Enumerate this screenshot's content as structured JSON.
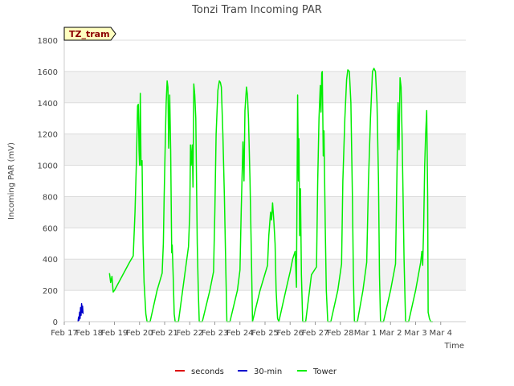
{
  "chart_data": {
    "type": "line",
    "title": "Tonzi Tram Incoming PAR",
    "xlabel": "Time",
    "ylabel": "Incoming PAR (mV)",
    "ylim": [
      0,
      1800
    ],
    "xlim": [
      0,
      16
    ],
    "yticks": [
      0,
      200,
      400,
      600,
      800,
      1000,
      1200,
      1400,
      1600,
      1800
    ],
    "xticks": [
      {
        "x": 0,
        "label": "Feb 17"
      },
      {
        "x": 1,
        "label": "Feb 18"
      },
      {
        "x": 2,
        "label": "Feb 19"
      },
      {
        "x": 3,
        "label": "Feb 20"
      },
      {
        "x": 4,
        "label": "Feb 21"
      },
      {
        "x": 5,
        "label": "Feb 22"
      },
      {
        "x": 6,
        "label": "Feb 23"
      },
      {
        "x": 7,
        "label": "Feb 24"
      },
      {
        "x": 8,
        "label": "Feb 25"
      },
      {
        "x": 9,
        "label": "Feb 26"
      },
      {
        "x": 10,
        "label": "Feb 27"
      },
      {
        "x": 11,
        "label": "Feb 28"
      },
      {
        "x": 12,
        "label": "Mar 1"
      },
      {
        "x": 13,
        "label": "Mar 2"
      },
      {
        "x": 14,
        "label": "Mar 3"
      },
      {
        "x": 15,
        "label": "Mar 4"
      }
    ],
    "grid": "horizontal bands",
    "legend_position": "bottom",
    "annotation": "TZ_tram",
    "series": [
      {
        "name": "seconds",
        "color": "#dd0000",
        "points": []
      },
      {
        "name": "30-min",
        "color": "#0000cc",
        "points": [
          [
            0.55,
            0
          ],
          [
            0.57,
            30
          ],
          [
            0.59,
            10
          ],
          [
            0.61,
            60
          ],
          [
            0.63,
            20
          ],
          [
            0.65,
            90
          ],
          [
            0.67,
            40
          ],
          [
            0.69,
            115
          ],
          [
            0.71,
            60
          ],
          [
            0.73,
            100
          ],
          [
            0.75,
            50
          ]
        ]
      },
      {
        "name": "Tower",
        "color": "#00ee00",
        "points": [
          [
            1.8,
            310
          ],
          [
            1.85,
            250
          ],
          [
            1.9,
            290
          ],
          [
            1.95,
            190
          ],
          [
            2.0,
            200
          ],
          [
            2.6,
            380
          ],
          [
            2.75,
            420
          ],
          [
            2.82,
            700
          ],
          [
            2.88,
            1050
          ],
          [
            2.92,
            1380
          ],
          [
            2.95,
            1390
          ],
          [
            2.98,
            1100
          ],
          [
            3.0,
            1000
          ],
          [
            3.03,
            1460
          ],
          [
            3.06,
            1000
          ],
          [
            3.1,
            1030
          ],
          [
            3.14,
            500
          ],
          [
            3.18,
            250
          ],
          [
            3.25,
            50
          ],
          [
            3.3,
            0
          ],
          [
            3.42,
            0
          ],
          [
            3.7,
            200
          ],
          [
            3.9,
            310
          ],
          [
            3.95,
            500
          ],
          [
            3.98,
            800
          ],
          [
            4.02,
            1100
          ],
          [
            4.06,
            1400
          ],
          [
            4.1,
            1540
          ],
          [
            4.13,
            1500
          ],
          [
            4.16,
            1110
          ],
          [
            4.2,
            1450
          ],
          [
            4.24,
            1100
          ],
          [
            4.28,
            440
          ],
          [
            4.3,
            490
          ],
          [
            4.34,
            300
          ],
          [
            4.38,
            50
          ],
          [
            4.42,
            0
          ],
          [
            4.55,
            0
          ],
          [
            4.8,
            300
          ],
          [
            4.95,
            480
          ],
          [
            5.0,
            700
          ],
          [
            5.03,
            1130
          ],
          [
            5.06,
            1000
          ],
          [
            5.1,
            1130
          ],
          [
            5.13,
            860
          ],
          [
            5.16,
            1520
          ],
          [
            5.2,
            1450
          ],
          [
            5.24,
            1300
          ],
          [
            5.27,
            900
          ],
          [
            5.3,
            500
          ],
          [
            5.34,
            200
          ],
          [
            5.38,
            0
          ],
          [
            5.5,
            0
          ],
          [
            5.8,
            200
          ],
          [
            5.95,
            320
          ],
          [
            6.0,
            700
          ],
          [
            6.05,
            1200
          ],
          [
            6.12,
            1480
          ],
          [
            6.18,
            1540
          ],
          [
            6.22,
            1530
          ],
          [
            6.26,
            1500
          ],
          [
            6.32,
            1200
          ],
          [
            6.38,
            800
          ],
          [
            6.44,
            300
          ],
          [
            6.48,
            0
          ],
          [
            6.6,
            0
          ],
          [
            6.9,
            200
          ],
          [
            7.0,
            330
          ],
          [
            7.05,
            700
          ],
          [
            7.12,
            1150
          ],
          [
            7.16,
            900
          ],
          [
            7.2,
            1350
          ],
          [
            7.26,
            1500
          ],
          [
            7.3,
            1450
          ],
          [
            7.34,
            1300
          ],
          [
            7.4,
            900
          ],
          [
            7.46,
            400
          ],
          [
            7.5,
            0
          ],
          [
            7.8,
            200
          ],
          [
            8.1,
            360
          ],
          [
            8.15,
            550
          ],
          [
            8.22,
            700
          ],
          [
            8.26,
            650
          ],
          [
            8.3,
            760
          ],
          [
            8.35,
            650
          ],
          [
            8.4,
            500
          ],
          [
            8.44,
            200
          ],
          [
            8.5,
            20
          ],
          [
            8.55,
            0
          ],
          [
            8.9,
            250
          ],
          [
            9.0,
            320
          ],
          [
            9.1,
            400
          ],
          [
            9.2,
            450
          ],
          [
            9.25,
            220
          ],
          [
            9.3,
            1450
          ],
          [
            9.33,
            900
          ],
          [
            9.35,
            1170
          ],
          [
            9.38,
            550
          ],
          [
            9.41,
            850
          ],
          [
            9.45,
            300
          ],
          [
            9.5,
            0
          ],
          [
            9.62,
            0
          ],
          [
            9.85,
            300
          ],
          [
            10.05,
            350
          ],
          [
            10.1,
            900
          ],
          [
            10.15,
            1300
          ],
          [
            10.2,
            1510
          ],
          [
            10.23,
            1340
          ],
          [
            10.26,
            1590
          ],
          [
            10.28,
            1600
          ],
          [
            10.32,
            1060
          ],
          [
            10.35,
            1220
          ],
          [
            10.4,
            600
          ],
          [
            10.44,
            200
          ],
          [
            10.5,
            0
          ],
          [
            10.62,
            0
          ],
          [
            10.9,
            200
          ],
          [
            11.05,
            370
          ],
          [
            11.1,
            900
          ],
          [
            11.18,
            1300
          ],
          [
            11.25,
            1550
          ],
          [
            11.3,
            1610
          ],
          [
            11.36,
            1600
          ],
          [
            11.42,
            1400
          ],
          [
            11.48,
            800
          ],
          [
            11.52,
            300
          ],
          [
            11.56,
            0
          ],
          [
            11.68,
            0
          ],
          [
            11.9,
            200
          ],
          [
            12.05,
            380
          ],
          [
            12.12,
            900
          ],
          [
            12.2,
            1300
          ],
          [
            12.28,
            1600
          ],
          [
            12.34,
            1620
          ],
          [
            12.4,
            1600
          ],
          [
            12.46,
            1400
          ],
          [
            12.52,
            900
          ],
          [
            12.56,
            300
          ],
          [
            12.6,
            0
          ],
          [
            12.72,
            0
          ],
          [
            13.0,
            200
          ],
          [
            13.2,
            370
          ],
          [
            13.25,
            900
          ],
          [
            13.3,
            1400
          ],
          [
            13.34,
            1100
          ],
          [
            13.38,
            1560
          ],
          [
            13.42,
            1500
          ],
          [
            13.46,
            1200
          ],
          [
            13.5,
            800
          ],
          [
            13.54,
            400
          ],
          [
            13.6,
            0
          ],
          [
            13.72,
            0
          ],
          [
            14.0,
            200
          ],
          [
            14.2,
            380
          ],
          [
            14.25,
            450
          ],
          [
            14.28,
            360
          ],
          [
            14.32,
            600
          ],
          [
            14.36,
            1000
          ],
          [
            14.4,
            1200
          ],
          [
            14.44,
            1350
          ],
          [
            14.48,
            800
          ],
          [
            14.5,
            60
          ],
          [
            14.55,
            20
          ],
          [
            14.6,
            0
          ],
          [
            14.68,
            0
          ]
        ]
      }
    ]
  }
}
